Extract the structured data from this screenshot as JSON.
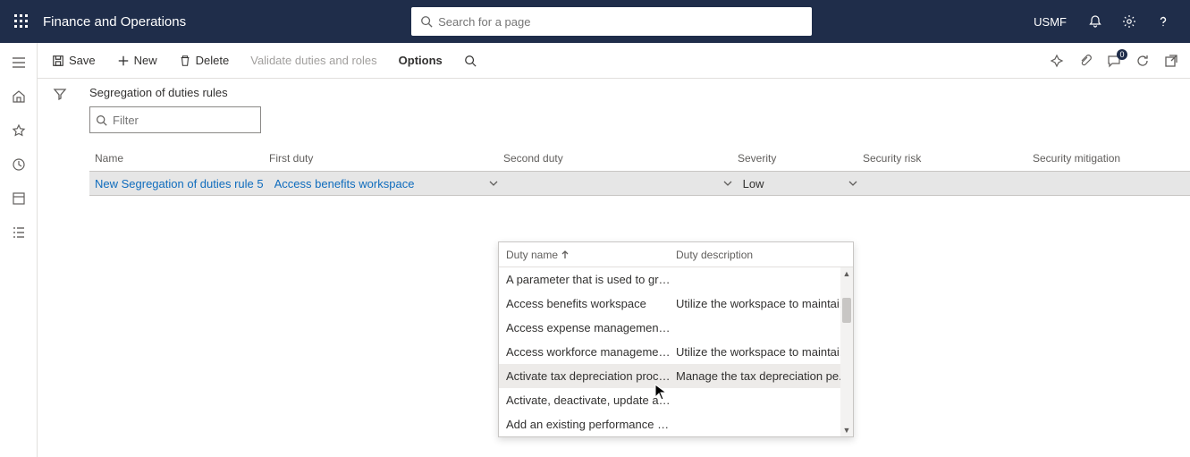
{
  "header": {
    "app_title": "Finance and Operations",
    "search_placeholder": "Search for a page",
    "company": "USMF"
  },
  "commands": {
    "save": "Save",
    "new": "New",
    "delete": "Delete",
    "validate": "Validate duties and roles",
    "options": "Options",
    "badge_count": "0"
  },
  "page": {
    "title": "Segregation of duties rules",
    "filter_placeholder": "Filter"
  },
  "grid": {
    "columns": {
      "name": "Name",
      "first_duty": "First duty",
      "second_duty": "Second duty",
      "severity": "Severity",
      "security_risk": "Security risk",
      "security_mitigation": "Security mitigation"
    },
    "row": {
      "name": "New Segregation of duties rule 5",
      "first_duty": "Access benefits workspace",
      "second_duty": "",
      "severity": "Low",
      "security_risk": "",
      "security_mitigation": ""
    }
  },
  "dropdown": {
    "col_name": "Duty name",
    "col_desc": "Duty description",
    "rows": [
      {
        "name": "A parameter that is used to gro...",
        "desc": ""
      },
      {
        "name": "Access benefits workspace",
        "desc": "Utilize the workspace to maintai..."
      },
      {
        "name": "Access expense management w...",
        "desc": ""
      },
      {
        "name": "Access workforce management ...",
        "desc": "Utilize the workspace to maintai..."
      },
      {
        "name": "Activate tax depreciation process",
        "desc": "Manage the tax depreciation pe..."
      },
      {
        "name": "Activate, deactivate, update and...",
        "desc": ""
      },
      {
        "name": "Add an existing performance jo...",
        "desc": ""
      }
    ]
  }
}
